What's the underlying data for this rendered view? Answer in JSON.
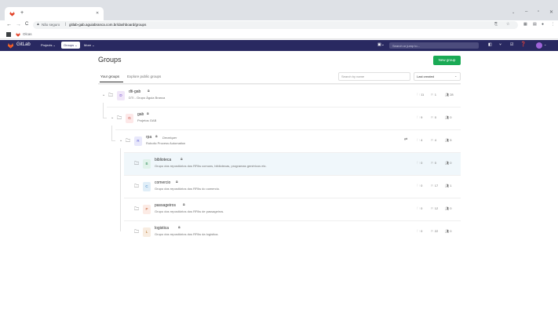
{
  "browser": {
    "tab_title": "",
    "security_label": "Não seguro",
    "url": "gitlab-gab.aguiabranca.com.br/dashboard/groups",
    "bookmark_label": "Olcas"
  },
  "nav": {
    "brand": "GitLab",
    "projects": "Projects ⌄",
    "groups": "Groups ⌄",
    "more": "More ⌄",
    "search_placeholder": "Search or jump to..."
  },
  "page": {
    "title": "Groups",
    "new_group": "New group",
    "tabs": [
      "Your groups",
      "Explore public groups"
    ],
    "search_placeholder": "Search by name",
    "sort_value": "Last created"
  },
  "groups": [
    {
      "initial": "D",
      "name": "dti-gab",
      "description": "DTI - Grupo Águia Branca",
      "subgroups": "11",
      "projects": "1",
      "members": "28",
      "role": ""
    },
    {
      "initial": "G",
      "name": "gab",
      "description": "Projetos GAB",
      "subgroups": "9",
      "projects": "0",
      "members": "0",
      "role": ""
    },
    {
      "initial": "R",
      "name": "rpa",
      "description": "Robotic Process Automation",
      "subgroups": "4",
      "projects": "4",
      "members": "5",
      "role": "Developer"
    },
    {
      "initial": "B",
      "name": "biblioteca",
      "description": "Grupo dos repositórios dos RPAs comuns, bibliotecas, programas genéricos etc.",
      "subgroups": "0",
      "projects": "0",
      "members": "0",
      "role": ""
    },
    {
      "initial": "C",
      "name": "comercio",
      "description": "Grupo dos repositórios dos RPAs do comercio.",
      "subgroups": "0",
      "projects": "17",
      "members": "1",
      "role": ""
    },
    {
      "initial": "P",
      "name": "passageiros",
      "description": "Grupo dos repositórios dos RPAs de passageiros.",
      "subgroups": "0",
      "projects": "12",
      "members": "0",
      "role": ""
    },
    {
      "initial": "L",
      "name": "logistica",
      "description": "Grupo dos repositórios dos RPAs da logística.",
      "subgroups": "0",
      "projects": "22",
      "members": "0",
      "role": ""
    }
  ],
  "colors": {
    "nav_bg": "#292961",
    "new_group_bg": "#1aaa55",
    "selected_row_bg": "#f0f7fb"
  }
}
